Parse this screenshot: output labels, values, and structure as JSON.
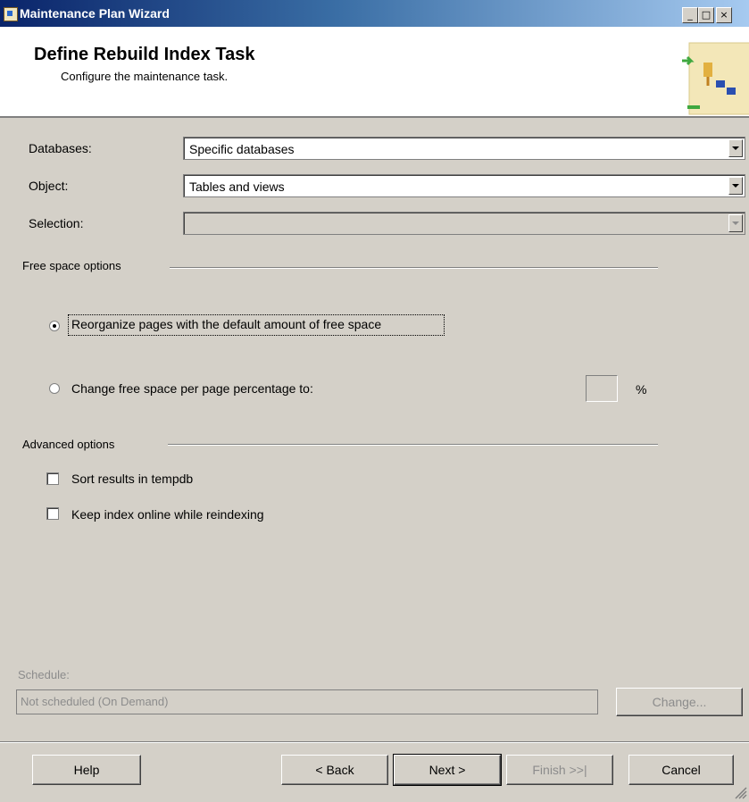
{
  "window": {
    "title": "Maintenance Plan Wizard",
    "caption_buttons": [
      "_",
      "□",
      "×"
    ]
  },
  "header": {
    "title": "Define Rebuild Index Task",
    "subtitle": "Configure the maintenance task."
  },
  "form": {
    "databases": {
      "label": "Databases:",
      "value": "Specific databases"
    },
    "object": {
      "label": "Object:",
      "value": "Tables and views"
    },
    "selection": {
      "label": "Selection:",
      "value": ""
    }
  },
  "free_space": {
    "group_label": "Free space options",
    "option_default": "Reorganize pages with the default amount of free space",
    "option_change": "Change free space per page percentage to:",
    "percent_value": "",
    "percent_suffix": "%",
    "selected": "default"
  },
  "advanced": {
    "group_label": "Advanced options",
    "sort_label": "Sort results in tempdb",
    "sort_checked": false,
    "online_label": "Keep index online while reindexing",
    "online_checked": false
  },
  "schedule": {
    "label": "Schedule:",
    "value": "Not scheduled (On Demand)",
    "change_button": "Change..."
  },
  "buttons": {
    "help": "Help",
    "back": "< Back",
    "next": "Next >",
    "finish": "Finish >>|",
    "cancel": "Cancel"
  }
}
